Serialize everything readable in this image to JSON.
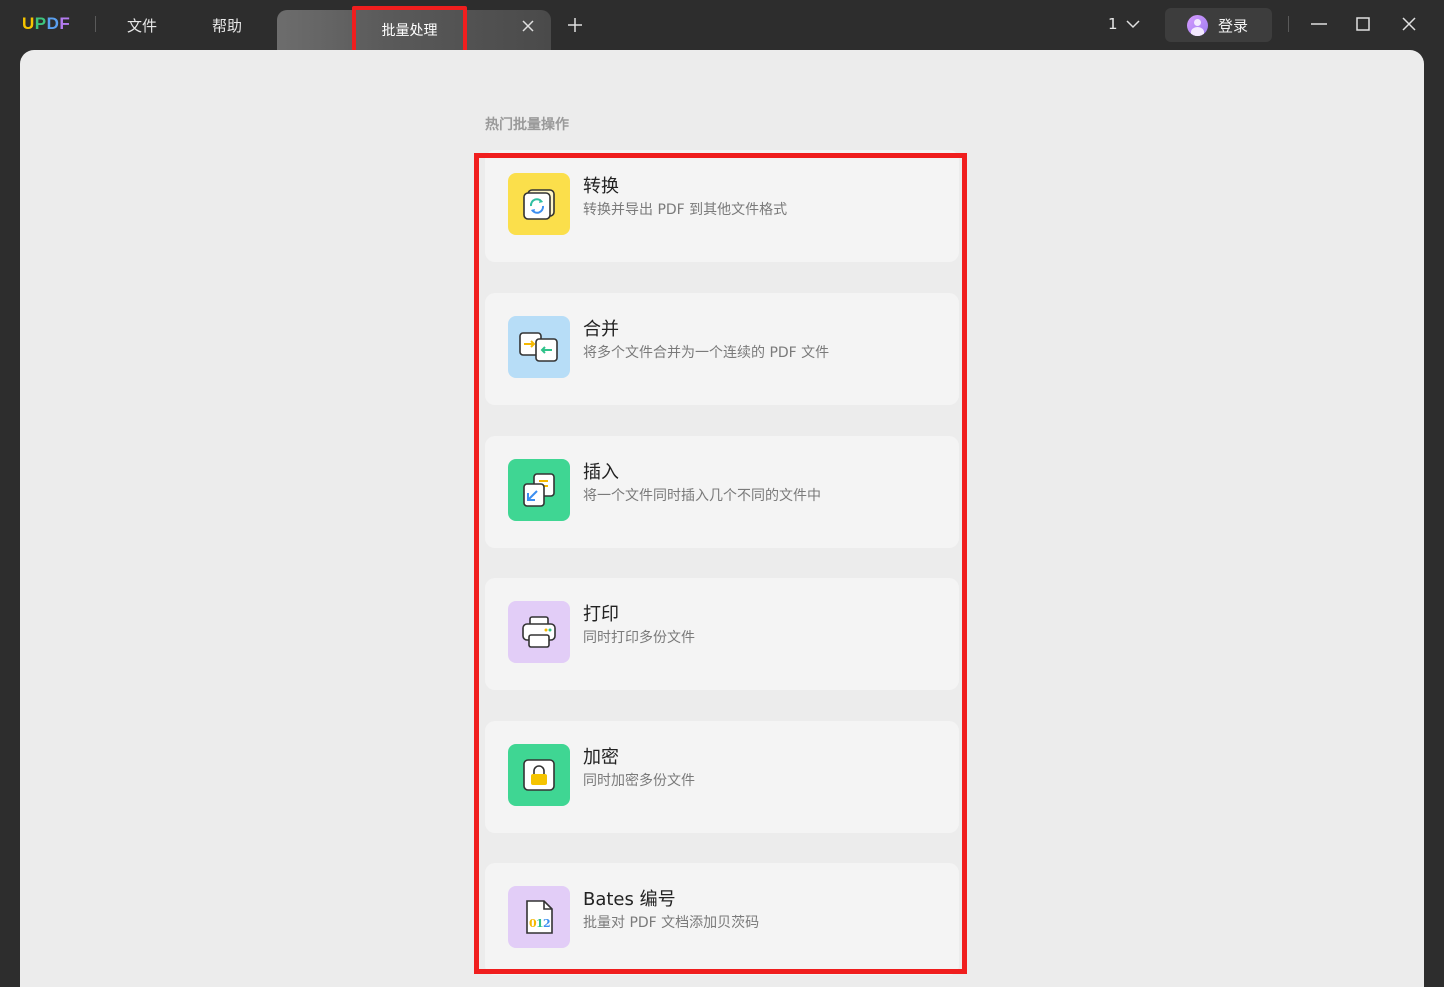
{
  "app": {
    "logo_letters": [
      {
        "char": "U",
        "color": "#f5c400"
      },
      {
        "char": "P",
        "color": "#3dc47e"
      },
      {
        "char": "D",
        "color": "#5aa0f0"
      },
      {
        "char": "F",
        "color": "#b47cf0"
      }
    ]
  },
  "menu": {
    "file": "文件",
    "help": "帮助"
  },
  "tab": {
    "label": "批量处理",
    "close": "×",
    "add": "+"
  },
  "topbar": {
    "page_number": "1",
    "login_label": "登录"
  },
  "section": {
    "title": "热门批量操作"
  },
  "items": [
    {
      "title": "转换",
      "desc": "转换并导出 PDF 到其他文件格式",
      "icon": "convert-icon",
      "bg": "#fbdf4b"
    },
    {
      "title": "合并",
      "desc": "将多个文件合并为一个连续的 PDF 文件",
      "icon": "merge-icon",
      "bg": "#b7ddf7"
    },
    {
      "title": "插入",
      "desc": "将一个文件同时插入几个不同的文件中",
      "icon": "insert-icon",
      "bg": "#3fd693"
    },
    {
      "title": "打印",
      "desc": "同时打印多份文件",
      "icon": "print-icon",
      "bg": "#e2cdf7"
    },
    {
      "title": "加密",
      "desc": "同时加密多份文件",
      "icon": "lock-icon",
      "bg": "#3fd693"
    },
    {
      "title": "Bates 编号",
      "desc": "批量对 PDF 文档添加贝茨码",
      "icon": "bates-number-icon",
      "bg": "#e2cdf7"
    }
  ]
}
